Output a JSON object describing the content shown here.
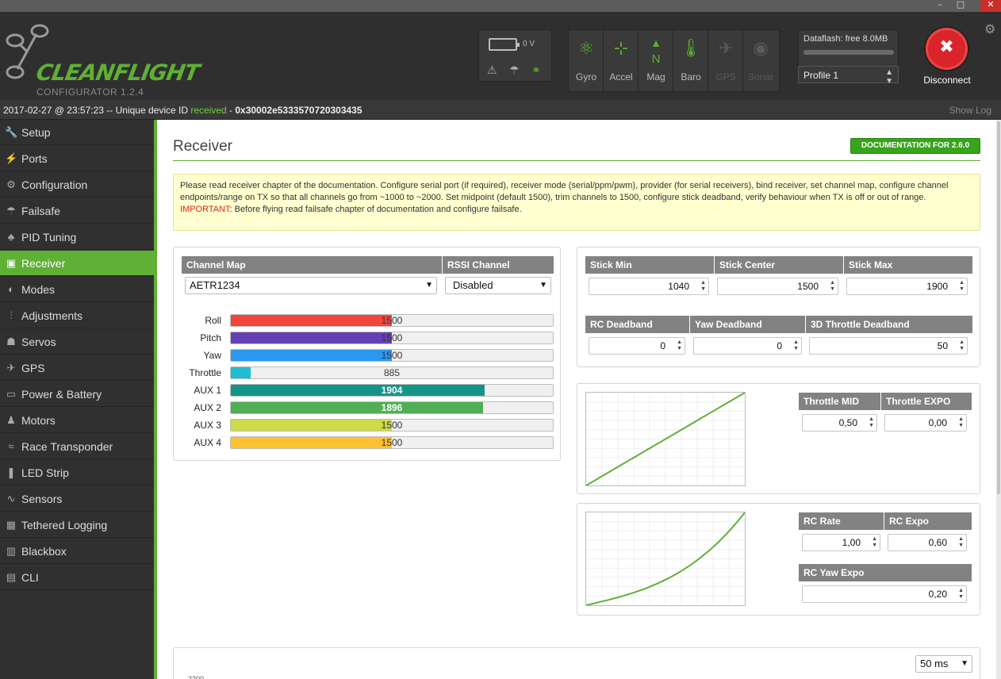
{
  "window": {
    "minimize": "–",
    "maximize": "□",
    "close": "✕"
  },
  "app": {
    "logo_text": "CLEANFLIGHT",
    "version": "CONFIGURATOR  1.2.4"
  },
  "battery": {
    "voltage": "0 V"
  },
  "sensors": [
    {
      "label": "Gyro",
      "icon": "gyro-icon",
      "glyph": "⚛",
      "active": true
    },
    {
      "label": "Accel",
      "icon": "accel-icon",
      "glyph": "⊹",
      "active": true
    },
    {
      "label": "Mag",
      "icon": "mag-icon",
      "glyph": "▲",
      "active": true
    },
    {
      "label": "Baro",
      "icon": "baro-icon",
      "glyph": "🌡",
      "active": true
    },
    {
      "label": "GPS",
      "icon": "gps-icon",
      "glyph": "✈",
      "active": false
    },
    {
      "label": "Sonar",
      "icon": "sonar-icon",
      "glyph": "◉",
      "active": false
    }
  ],
  "mag_letter": "N",
  "dataflash": {
    "label": "Dataflash: free 8.0MB"
  },
  "profile": {
    "selected": "Profile 1"
  },
  "connection": {
    "disconnect_label": "Disconnect"
  },
  "status": {
    "prefix": "2017-02-27 @ 23:57:23 -- Unique device ID ",
    "received": "received",
    "dash": " - ",
    "device_id": "0x30002e5333570720303435",
    "show_log": "Show Log"
  },
  "nav": [
    {
      "label": "Setup",
      "icon": "wrench-icon",
      "glyph": "🔧"
    },
    {
      "label": "Ports",
      "icon": "ports-icon",
      "glyph": "⚡"
    },
    {
      "label": "Configuration",
      "icon": "gear-icon",
      "glyph": "⚙"
    },
    {
      "label": "Failsafe",
      "icon": "parachute-icon",
      "glyph": "☂"
    },
    {
      "label": "PID Tuning",
      "icon": "pid-icon",
      "glyph": "♣"
    },
    {
      "label": "Receiver",
      "icon": "receiver-icon",
      "glyph": "▣"
    },
    {
      "label": "Modes",
      "icon": "modes-icon",
      "glyph": "◐"
    },
    {
      "label": "Adjustments",
      "icon": "sliders-icon",
      "glyph": "⫶"
    },
    {
      "label": "Servos",
      "icon": "servo-icon",
      "glyph": "☗"
    },
    {
      "label": "GPS",
      "icon": "satellite-icon",
      "glyph": "✈"
    },
    {
      "label": "Power & Battery",
      "icon": "battery-icon",
      "glyph": "▭"
    },
    {
      "label": "Motors",
      "icon": "motor-icon",
      "glyph": "♟"
    },
    {
      "label": "Race Transponder",
      "icon": "transponder-icon",
      "glyph": "≈"
    },
    {
      "label": "LED Strip",
      "icon": "led-icon",
      "glyph": "❚"
    },
    {
      "label": "Sensors",
      "icon": "pulse-icon",
      "glyph": "∿"
    },
    {
      "label": "Tethered Logging",
      "icon": "keyboard-icon",
      "glyph": "▦"
    },
    {
      "label": "Blackbox",
      "icon": "blackbox-icon",
      "glyph": "▥"
    },
    {
      "label": "CLI",
      "icon": "terminal-icon",
      "glyph": "▤"
    }
  ],
  "active_nav": "Receiver",
  "page": {
    "title": "Receiver",
    "doc_button": "DOCUMENTATION FOR 2.6.0",
    "note": "Please read receiver chapter of the documentation. Configure serial port (if required), receiver mode (serial/ppm/pwm), provider (for serial receivers), bind receiver, set channel map, configure channel endpoints/range on TX so that all channels go from ~1000 to ~2000. Set midpoint (default 1500), trim channels to 1500, configure stick deadband, verify behaviour when TX is off or out of range.",
    "important_label": "IMPORTANT",
    "important_text": ": Before flying read failsafe chapter of documentation and configure failsafe."
  },
  "channel_map": {
    "header": "Channel Map",
    "value": "AETR1234"
  },
  "rssi": {
    "header": "RSSI Channel",
    "value": "Disabled"
  },
  "channels": [
    {
      "name": "Roll",
      "value": 1500,
      "color": "#f1453d"
    },
    {
      "name": "Pitch",
      "value": 1500,
      "color": "#673fb4"
    },
    {
      "name": "Yaw",
      "value": 1500,
      "color": "#2b98f0"
    },
    {
      "name": "Throttle",
      "value": 885,
      "color": "#1fbcd2"
    },
    {
      "name": "AUX 1",
      "value": 1904,
      "color": "#159588"
    },
    {
      "name": "AUX 2",
      "value": 1896,
      "color": "#50ae55"
    },
    {
      "name": "AUX 3",
      "value": 1500,
      "color": "#cdda49"
    },
    {
      "name": "AUX 4",
      "value": 1500,
      "color": "#fdc02f"
    }
  ],
  "channel_range": [
    800,
    2200
  ],
  "stick": {
    "min_label": "Stick Min",
    "min": "1040",
    "center_label": "Stick Center",
    "center": "1500",
    "max_label": "Stick Max",
    "max": "1900"
  },
  "deadband": {
    "rc_label": "RC Deadband",
    "rc": "0",
    "yaw_label": "Yaw Deadband",
    "yaw": "0",
    "throttle3d_label": "3D Throttle Deadband",
    "throttle3d": "50"
  },
  "throttle_curve": {
    "mid_label": "Throttle MID",
    "mid": "0,50",
    "expo_label": "Throttle EXPO",
    "expo": "0,00"
  },
  "rc_curve": {
    "rate_label": "RC Rate",
    "rate": "1,00",
    "expo_label": "RC Expo",
    "expo": "0,60",
    "yaw_expo_label": "RC Yaw Expo",
    "yaw_expo": "0,20"
  },
  "chart": {
    "refresh": "50 ms",
    "top_tick": "2200"
  },
  "colors": {
    "accent": "#5fb035",
    "header_bg": "#2f2f2f",
    "disconnect": "#d9252a"
  }
}
